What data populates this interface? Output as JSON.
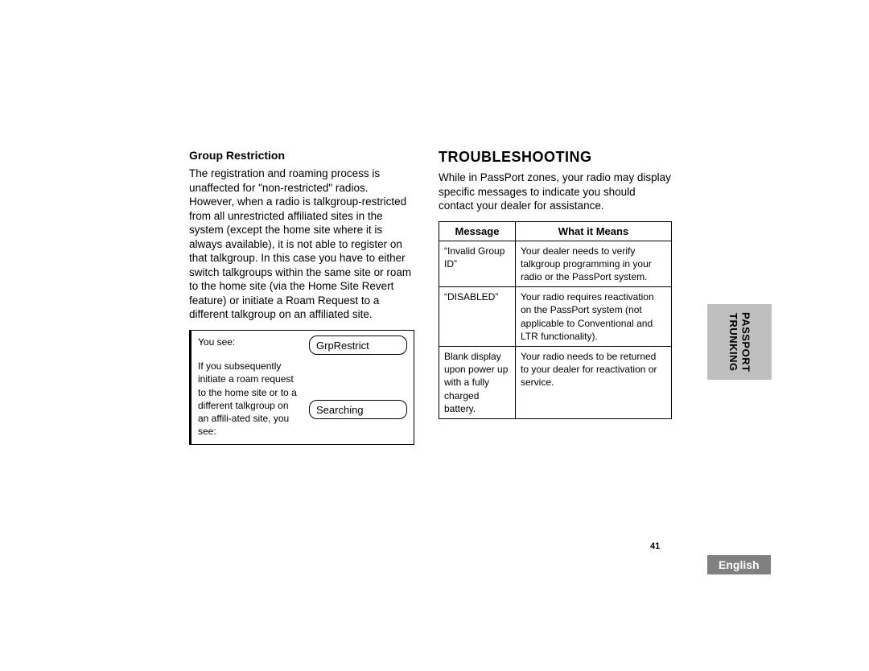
{
  "left": {
    "heading": "Group Restriction",
    "paragraph": "The registration and roaming process is unaffected for \"non-restricted\" radios. However, when a radio is talkgroup-restricted from all unrestricted affiliated sites in the system (except the home site where it is always available), it is not able to register on that talkgroup. In this case you have to either switch talkgroups within the same site or roam to the home site (via the Home Site Revert feature) or initiate a Roam Request to a different talkgroup on an affiliated site.",
    "callout": {
      "line1": "You see:",
      "line2": "If you subsequently initiate a roam request to the home site or to a different talkgroup on an affili-ated site, you see:",
      "chip1": "GrpRestrict",
      "chip2": "Searching"
    }
  },
  "right": {
    "heading": "TROUBLESHOOTING",
    "paragraph": "While in PassPort zones, your radio may display specific messages to indicate you should contact your dealer for assistance.",
    "table": {
      "col1": "Message",
      "col2": "What it Means",
      "rows": [
        {
          "msg": "“Invalid Group ID”",
          "meaning": "Your dealer needs to verify talkgroup programming in your radio or the PassPort system."
        },
        {
          "msg": "“DISABLED”",
          "meaning": "Your radio requires reactivation on the PassPort system (not applicable to Conventional and LTR functionality)."
        },
        {
          "msg": "Blank display upon power up with a fully charged battery.",
          "meaning": "Your radio needs to be returned to your dealer for reactivation or service."
        }
      ]
    }
  },
  "page_number": "41",
  "side_tab": "PASSPORT\nTRUNKING",
  "language": "English"
}
